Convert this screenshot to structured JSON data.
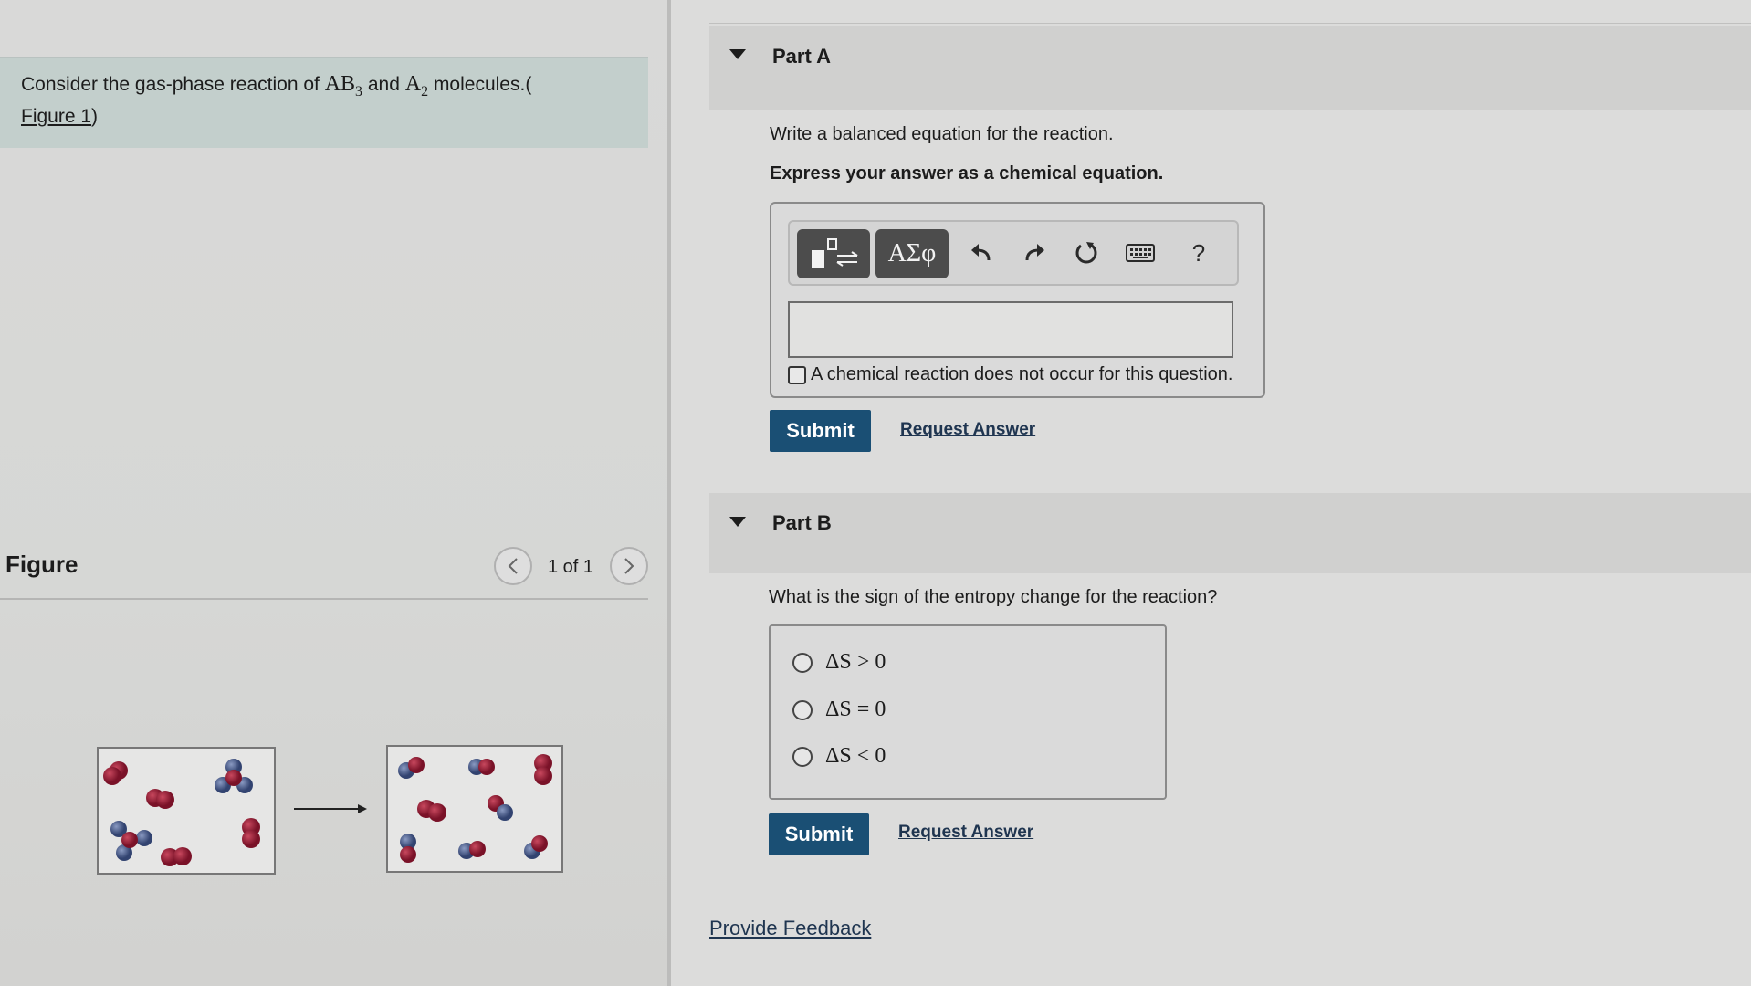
{
  "intro": {
    "prefix": "Consider the gas-phase reaction of ",
    "molecule_1": "AB",
    "molecule_1_sub": "3",
    "conjunction": " and ",
    "molecule_2": "A",
    "molecule_2_sub": "2",
    "suffix": " molecules.(",
    "figure_link": "Figure 1",
    "close": ")"
  },
  "figure": {
    "title": "Figure",
    "page_indicator": "1 of 1"
  },
  "part_a": {
    "title": "Part A",
    "question": "Write a balanced equation for the reaction.",
    "instruction": "Express your answer as a chemical equation.",
    "symbols_label": "ΑΣφ",
    "help_label": "?",
    "no_reaction_label": "A chemical reaction does not occur for this question.",
    "submit_label": "Submit",
    "request_label": "Request Answer"
  },
  "part_b": {
    "title": "Part B",
    "question": "What is the sign of the entropy change for the reaction?",
    "options": [
      "ΔS > 0",
      "ΔS = 0",
      "ΔS < 0"
    ],
    "submit_label": "Submit",
    "request_label": "Request Answer"
  },
  "feedback_label": "Provide Feedback",
  "colors": {
    "submit_bg": "#1a4f74",
    "atom_a": "#8c1b32",
    "atom_b": "#4a5c86"
  },
  "icons": [
    "template-icon",
    "undo-icon",
    "redo-icon",
    "reset-icon",
    "keyboard-icon",
    "chevron-left-icon",
    "chevron-right-icon"
  ]
}
